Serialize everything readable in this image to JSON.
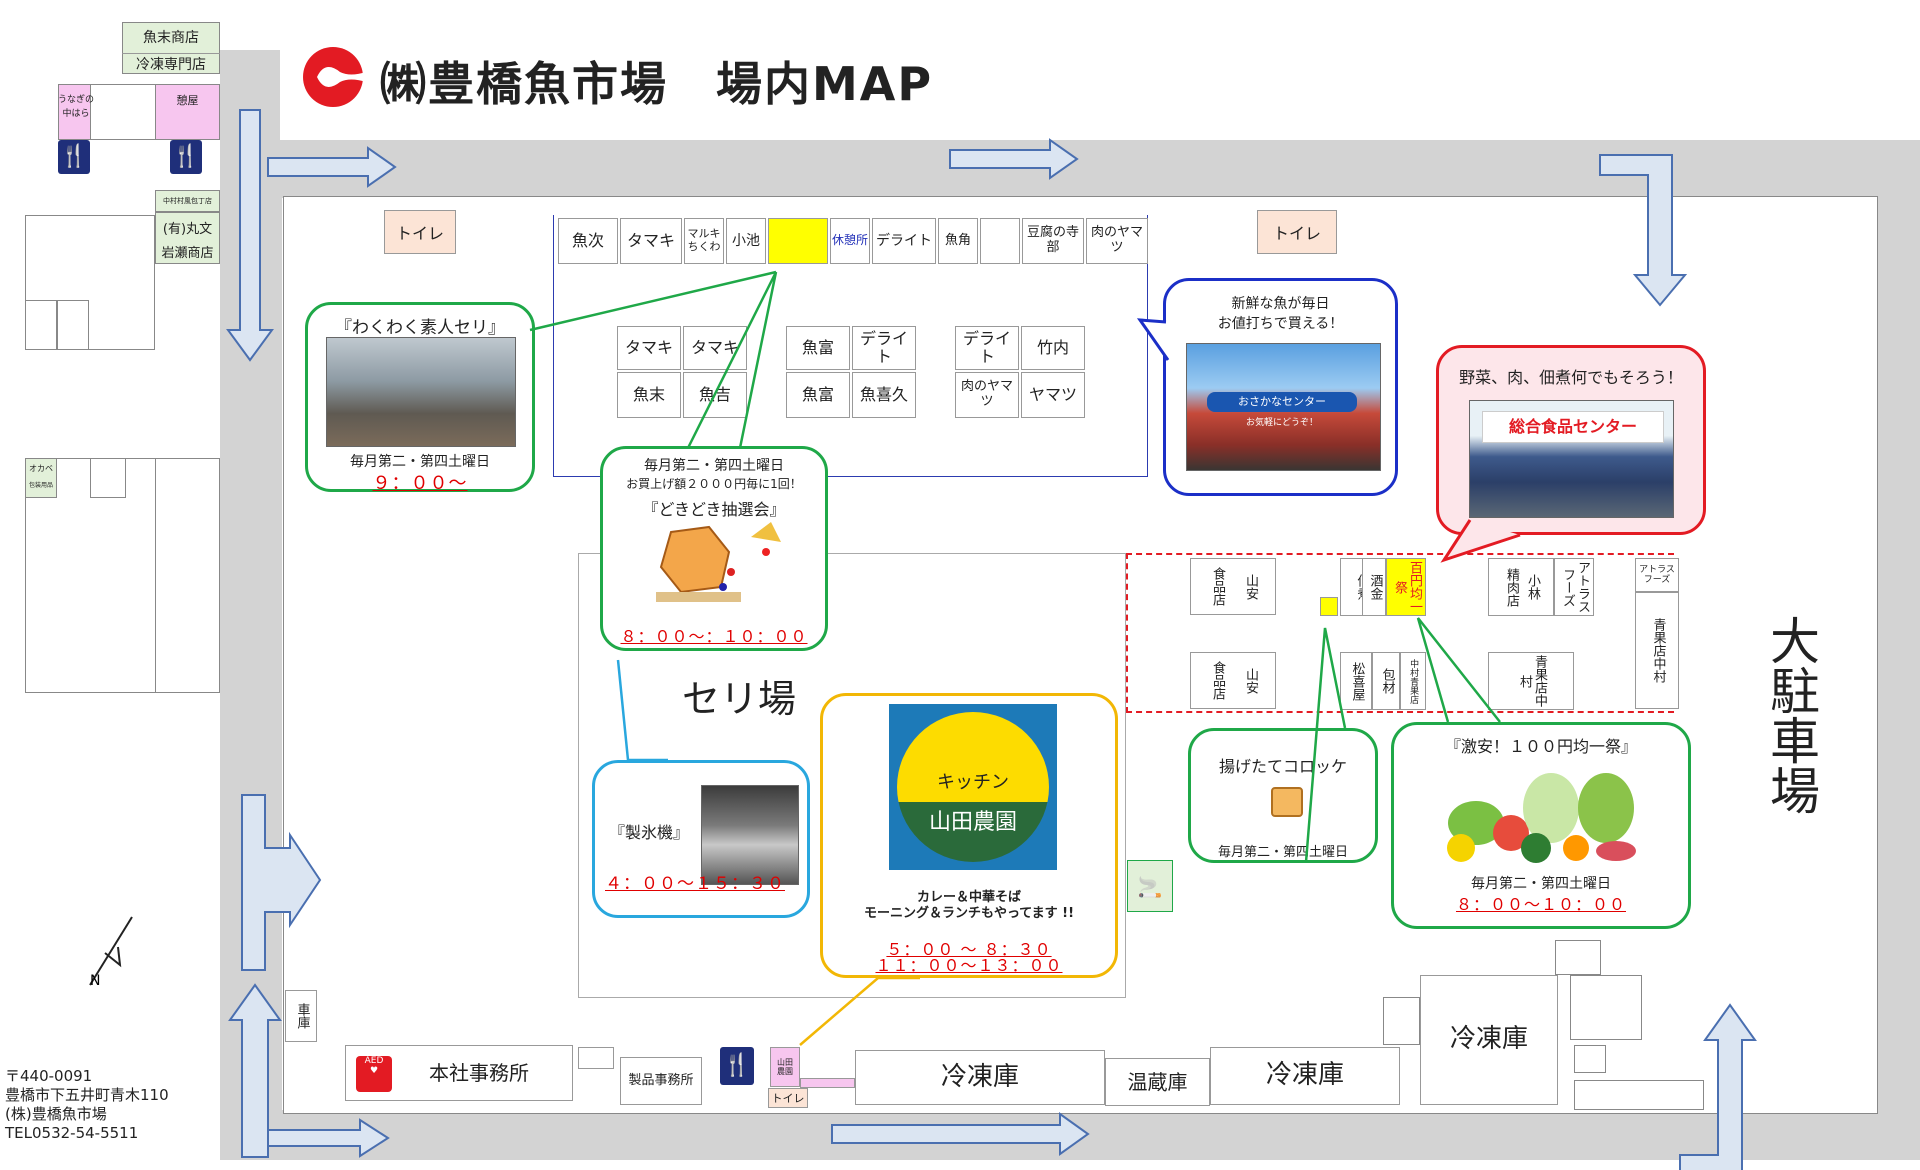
{
  "header": {
    "title": "㈱豊橋魚市場　場内MAP"
  },
  "left_strip": {
    "shop_top": "魚末商店",
    "shop_top2": "冷凍専門店",
    "unagi_line1": "うなぎの",
    "unagi_line2": "中はら",
    "rest_pink": "憩屋",
    "nakamura_knife": "中村村風包丁店",
    "marubun": "(有)丸文",
    "iwase": "岩瀬商店",
    "okabe": "オカベ",
    "okabe_sub": "包装用品"
  },
  "toilets": {
    "left": "トイレ",
    "right": "トイレ",
    "bottom": "トイレ"
  },
  "row1": [
    "魚次",
    "タマキ",
    "マルキちくわ",
    "小池",
    "",
    "休憩所",
    "デライト",
    "魚角",
    "",
    "豆腐の寺部",
    "肉のヤマツ"
  ],
  "row2": [
    "タマキ",
    "タマキ",
    "魚富",
    "デライト",
    "デライト",
    "竹内"
  ],
  "row3": [
    "魚末",
    "魚吉",
    "魚富",
    "魚喜久",
    "肉のヤマツ",
    "ヤマツ"
  ],
  "right_stalls": {
    "shokuhin_yamayasu_1_a": "食品店",
    "shokuhin_yamayasu_1_b": "山安",
    "shokuhin_yamayasu_2_a": "食品店",
    "shokuhin_yamayasu_2_b": "山安",
    "tsukudani": "佃煮",
    "sakakin": "酒金",
    "hyakuen": "百円均一祭",
    "matsukiya": "松喜屋",
    "horikin": "包材",
    "nakamura_seika": "中村青果店",
    "seinikuten": "精肉店",
    "kobayashi": "小林",
    "atorasu": "アトラスフーズ",
    "atorasu2": "アトラスフーズ",
    "seika_nakamura": "青果店中村",
    "seika_nakamura2": "青果店中村"
  },
  "seri": "セリ場",
  "parking": "大駐車場",
  "bottom": {
    "garage": "車庫",
    "honsha": "本社事務所",
    "aed": "AED",
    "seihin": "製品事務所",
    "yamada_small1": "山田",
    "yamada_small2": "農園",
    "reitoko1": "冷凍庫",
    "onzoko": "温蔵庫",
    "reitoko2": "冷凍庫",
    "reitoko3": "冷凍庫"
  },
  "address": {
    "zip": "〒440-0091",
    "addr": "豊橋市下五井町青木110",
    "company": "(株)豊橋魚市場",
    "tel": "TEL0532-54-5511"
  },
  "bubbles": {
    "wakuwaku": {
      "title": "『わくわく素人セリ』",
      "sched": "毎月第二・第四土曜日",
      "time": "９：００～"
    },
    "dokidoki": {
      "sched": "毎月第二・第四土曜日",
      "note": "お買上げ額２０００円毎に1回！",
      "title": "『どきどき抽選会』",
      "time": "８：００～：１０：００"
    },
    "osakana": {
      "line1": "新鮮な魚が毎日",
      "line2": "お値打ちで買える！",
      "sign": "おさかなセンター",
      "sign_sub": "お気軽にどうぞ！"
    },
    "shokuhin": {
      "title": "野菜、肉、佃煮何でもそろう！",
      "sign": "総合食品センター"
    },
    "seihyoki": {
      "title": "『製氷機』",
      "time": "４：００～１５：３０"
    },
    "kitchen": {
      "logo_top": "キッチン",
      "logo_bottom": "山田農園",
      "line1": "カレー＆中華そば",
      "line2": "モーニング＆ランチもやってます !!",
      "time1": "５：００ ～ ８：３０",
      "time2": "１１：００～１３：００"
    },
    "korokke": {
      "title": "揚げたてコロッケ",
      "sched": "毎月第二・第四土曜日"
    },
    "gekiyasu": {
      "title": "『激安！１００円均一祭』",
      "sched": "毎月第二・第四土曜日",
      "time": "８：００～１０：００"
    }
  },
  "icons": {
    "logo": "company-logo",
    "restaurant": "knife-fork-icon",
    "aed": "aed-icon",
    "smoking": "smoking-area-icon",
    "north": "north-arrow-icon",
    "arrow": "direction-arrow-icon"
  },
  "colors": {
    "green_bubble": "#1fa848",
    "blue_bubble": "#1b2fc7",
    "red_bubble": "#e31b23",
    "cyan_bubble": "#29a7de",
    "orange_bubble": "#f2b705",
    "arrow_fill": "#dbe5f2",
    "arrow_stroke": "#4a6fb0",
    "yellow_stall": "#ffff00"
  }
}
